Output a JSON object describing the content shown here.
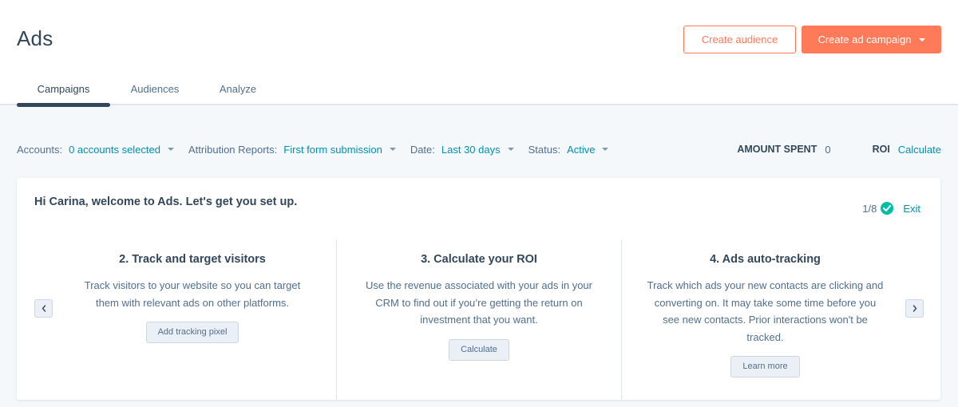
{
  "header": {
    "title": "Ads",
    "create_audience_label": "Create audience",
    "create_campaign_label": "Create ad campaign",
    "tabs": [
      {
        "label": "Campaigns",
        "active": true
      },
      {
        "label": "Audiences",
        "active": false
      },
      {
        "label": "Analyze",
        "active": false
      }
    ]
  },
  "filters": {
    "accounts": {
      "label": "Accounts:",
      "value": "0 accounts selected"
    },
    "attribution": {
      "label": "Attribution Reports:",
      "value": "First form submission"
    },
    "date": {
      "label": "Date:",
      "value": "Last 30 days"
    },
    "status": {
      "label": "Status:",
      "value": "Active"
    }
  },
  "metrics": {
    "amount_spent_label": "AMOUNT SPENT",
    "amount_spent_value": "0",
    "roi_label": "ROI",
    "roi_action": "Calculate"
  },
  "onboarding": {
    "welcome": "Hi Carina, welcome to Ads. Let's get you set up.",
    "progress": "1/8",
    "exit_label": "Exit",
    "steps": [
      {
        "title": "2. Track and target visitors",
        "description": "Track visitors to your website so you can target them with relevant ads on other platforms.",
        "button": "Add tracking pixel"
      },
      {
        "title": "3. Calculate your ROI",
        "description": "Use the revenue associated with your ads in your CRM to find out if you’re getting the return on investment that you want.",
        "button": "Calculate"
      },
      {
        "title": "4. Ads auto-tracking",
        "description": "Track which ads your new contacts are clicking and converting on. It may take some time before you see new contacts. Prior interactions won't be tracked.",
        "button": "Learn more"
      }
    ],
    "prev_icon": "chevron-left-icon",
    "next_icon": "chevron-right-icon"
  },
  "colors": {
    "accent": "#ff7a59",
    "link": "#0091ae",
    "text": "#33475b",
    "success": "#00bda5",
    "background": "#f5f8fa"
  }
}
